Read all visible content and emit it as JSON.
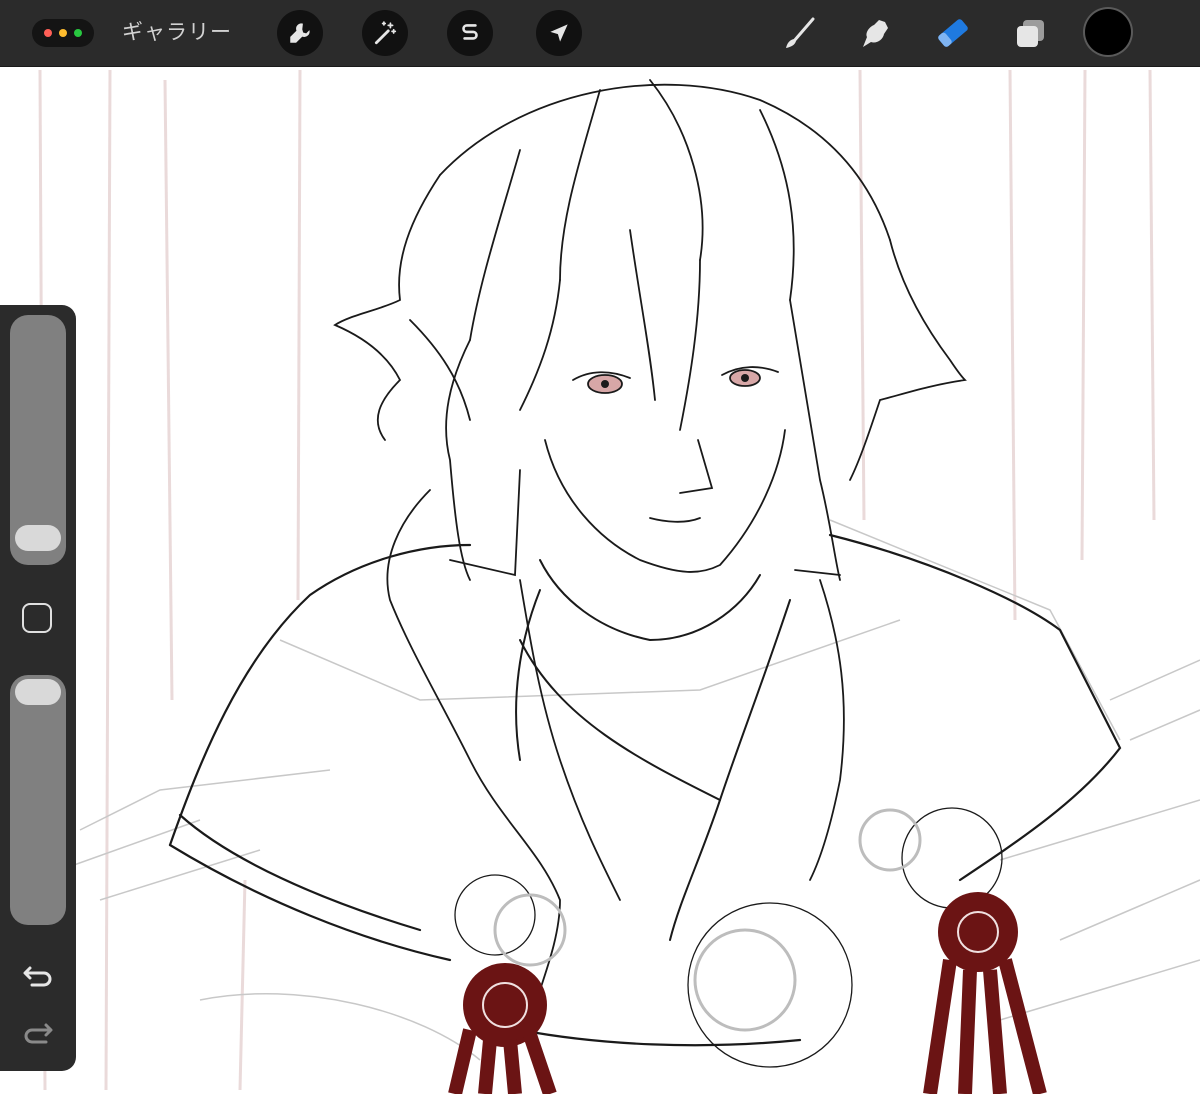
{
  "toolbar": {
    "gallery_label": "ギャラリー",
    "left_tools": [
      "wrench-icon",
      "magic-wand-icon",
      "selection-s-icon",
      "transform-arrow-icon"
    ],
    "right_tools": [
      "brush-icon",
      "smudge-icon",
      "eraser-icon",
      "layers-icon"
    ],
    "active_tool": "eraser",
    "accent_color": "#1f7ae0",
    "current_color": "#000000"
  },
  "sidebar": {
    "brush_size_level": 0.12,
    "opacity_level": 0.95,
    "tools": [
      "size-slider",
      "modify-button",
      "opacity-slider",
      "undo-icon",
      "redo-icon"
    ]
  },
  "artwork": {
    "ink_color": "#1a1a1a",
    "tassel_color": "#6b1414",
    "eye_color": "#d7a7a7"
  }
}
